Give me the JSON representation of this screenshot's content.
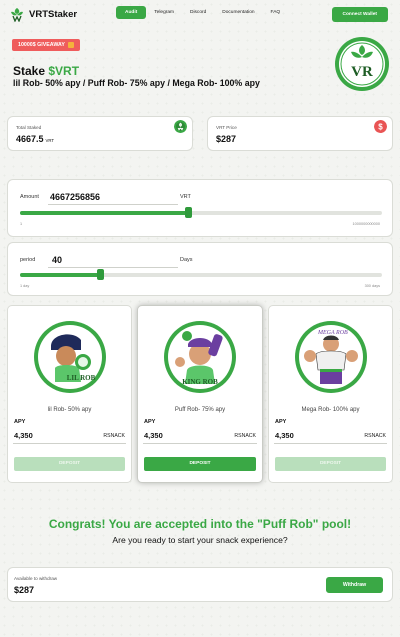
{
  "app": {
    "name": "VRTStaker"
  },
  "nav": {
    "links": [
      "Audit",
      "Telegram",
      "Discord",
      "Documentation",
      "FAQ"
    ],
    "active_index": 0,
    "connect_label": "Connect Wallet"
  },
  "banner": {
    "giveaway": "10000$ GIVEAWAY"
  },
  "hero": {
    "title_prefix": "Stake ",
    "title_ticker": "$VRT",
    "subtitle": "lil Rob- 50% apy / Puff Rob- 75% apy / Mega Rob- 100% apy",
    "badge_text": "VR"
  },
  "stats": {
    "total_staked": {
      "label": "Total Staked",
      "value": "4667.5",
      "unit": "VRT"
    },
    "vrt_price": {
      "label": "VRT Price",
      "value": "$287",
      "icon": "dollar-coin-icon"
    }
  },
  "amount_slider": {
    "label": "Amount",
    "value": "4667256856",
    "unit": "VRT",
    "min_label": "1",
    "max_label": "1000000000000",
    "fraction": 0.465
  },
  "period_slider": {
    "label": "period",
    "value": "40",
    "unit": "Days",
    "min_label": "1 day",
    "max_label": "300 days",
    "fraction": 0.22
  },
  "pools": [
    {
      "art_text": "LIL ROB",
      "name": "lil Rob- 50% apy",
      "apy_label": "APY",
      "amount": "4,350",
      "unit": "RSNACK",
      "button": "DEPOSIT",
      "enabled": false,
      "selected": false
    },
    {
      "art_text": "KING ROB",
      "name": "Puff Rob- 75% apy",
      "apy_label": "APY",
      "amount": "4,350",
      "unit": "RSNACK",
      "button": "DEPOSIT",
      "enabled": true,
      "selected": true
    },
    {
      "art_text": "MEGA ROB",
      "name": "Mega Rob- 100% apy",
      "apy_label": "APY",
      "amount": "4,350",
      "unit": "RSNACK",
      "button": "DEPOSIT",
      "enabled": false,
      "selected": false
    }
  ],
  "message": {
    "congrats": "Congrats! You are accepted into the \"Puff Rob\" pool!",
    "question": "Are you ready to start your snack experience?"
  },
  "withdraw": {
    "label": "Available to withdraw",
    "value": "$287",
    "button": "Withdraw"
  },
  "colors": {
    "accent": "#3aa845",
    "giveaway": "#ef5c5c",
    "price_coin": "#e95454"
  }
}
